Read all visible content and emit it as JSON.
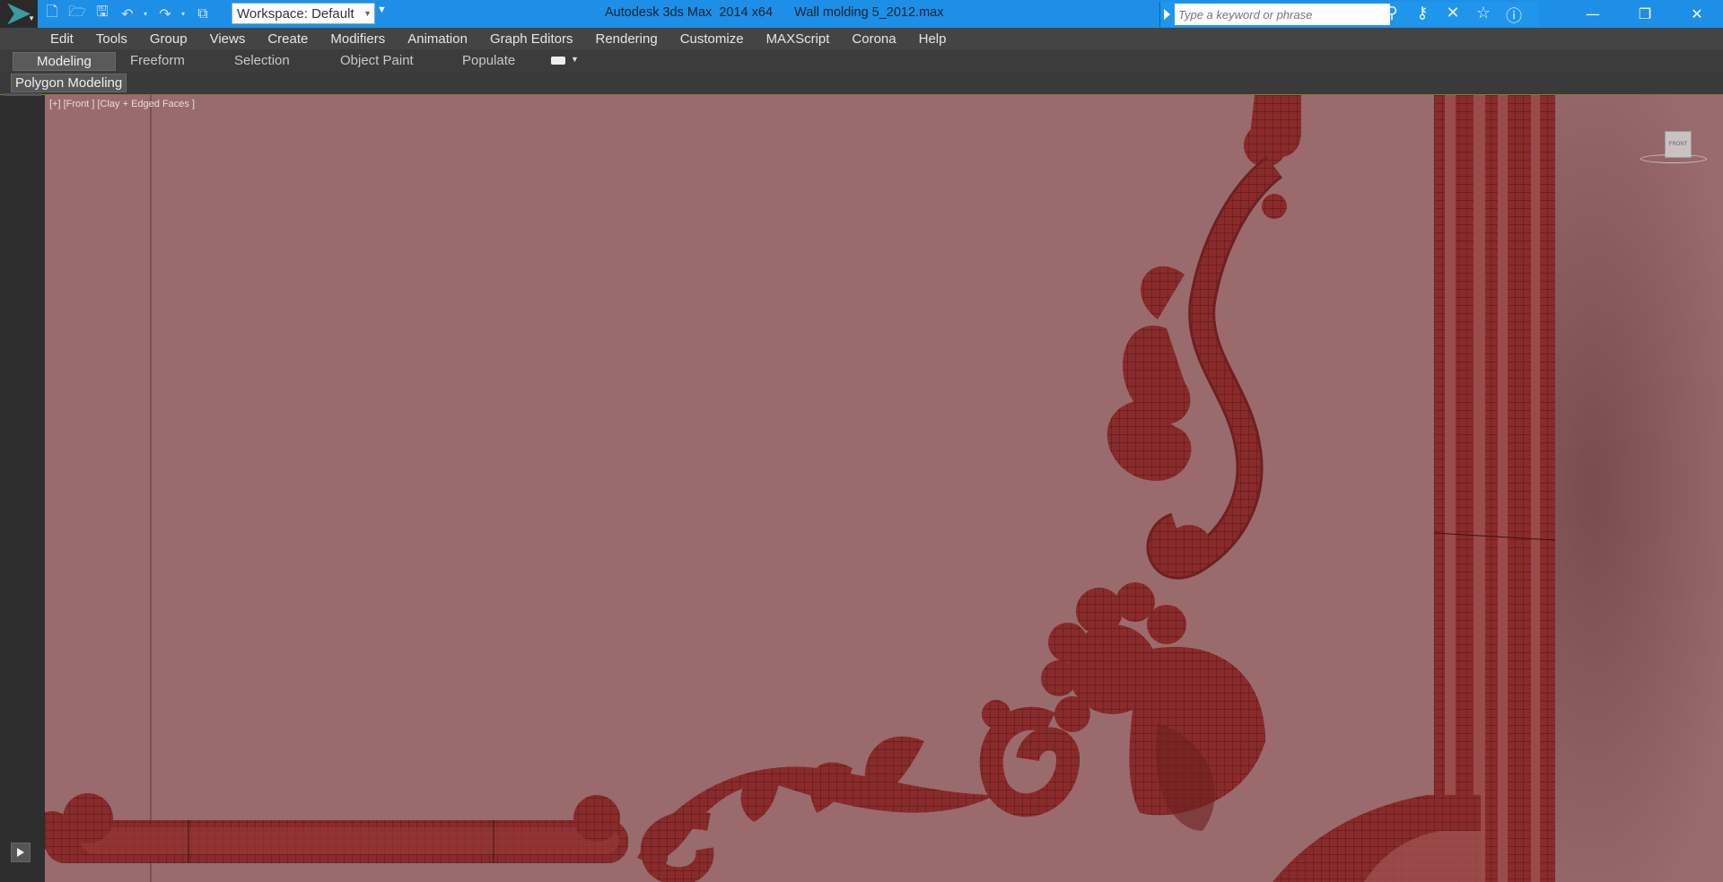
{
  "titlebar": {
    "workspace_label": "Workspace: Default",
    "title": "Autodesk 3ds Max  2014 x64      Wall molding 5_2012.max",
    "search_placeholder": "Type a keyword or phrase",
    "quick_access_icons": [
      "new-file-icon",
      "open-file-icon",
      "save-icon",
      "undo-icon",
      "redo-icon",
      "project-folder-icon"
    ],
    "search_icons": [
      "binoculars-icon",
      "subscription-icon",
      "communication-icon",
      "favorites-icon",
      "help-icon"
    ]
  },
  "menu": {
    "items": [
      "Edit",
      "Tools",
      "Group",
      "Views",
      "Create",
      "Modifiers",
      "Animation",
      "Graph Editors",
      "Rendering",
      "Customize",
      "MAXScript",
      "Corona",
      "Help"
    ]
  },
  "ribbon": {
    "tabs": [
      "Modeling",
      "Freeform",
      "Selection",
      "Object Paint",
      "Populate"
    ],
    "active_tab": "Modeling",
    "panel_label": "Polygon Modeling"
  },
  "viewport": {
    "label": "[+] [Front ] [Clay + Edged Faces ]",
    "viewcube_label": "FRONT",
    "background_color": "#9a6b6d",
    "model_color": "#8a2b2b"
  }
}
